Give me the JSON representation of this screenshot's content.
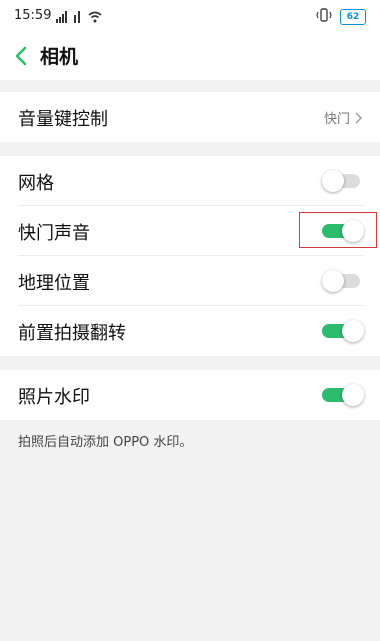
{
  "status_bar": {
    "time": "15:59",
    "signal_label": "all",
    "battery": "62"
  },
  "header": {
    "title": "相机"
  },
  "volume_key_row": {
    "label": "音量键控制",
    "value": "快门"
  },
  "settings": {
    "grid": {
      "label": "网格",
      "on": false
    },
    "shutter_sound": {
      "label": "快门声音",
      "on": true
    },
    "location": {
      "label": "地理位置",
      "on": false
    },
    "front_flip": {
      "label": "前置拍摄翻转",
      "on": true
    },
    "watermark": {
      "label": "照片水印",
      "on": true
    }
  },
  "watermark_note": "拍照后自动添加 OPPO 水印。",
  "colors": {
    "toggle_on": "#2dbb6d",
    "toggle_off": "#dcdcdc",
    "highlight": "#d93a3a",
    "battery": "#0e8fd6"
  }
}
